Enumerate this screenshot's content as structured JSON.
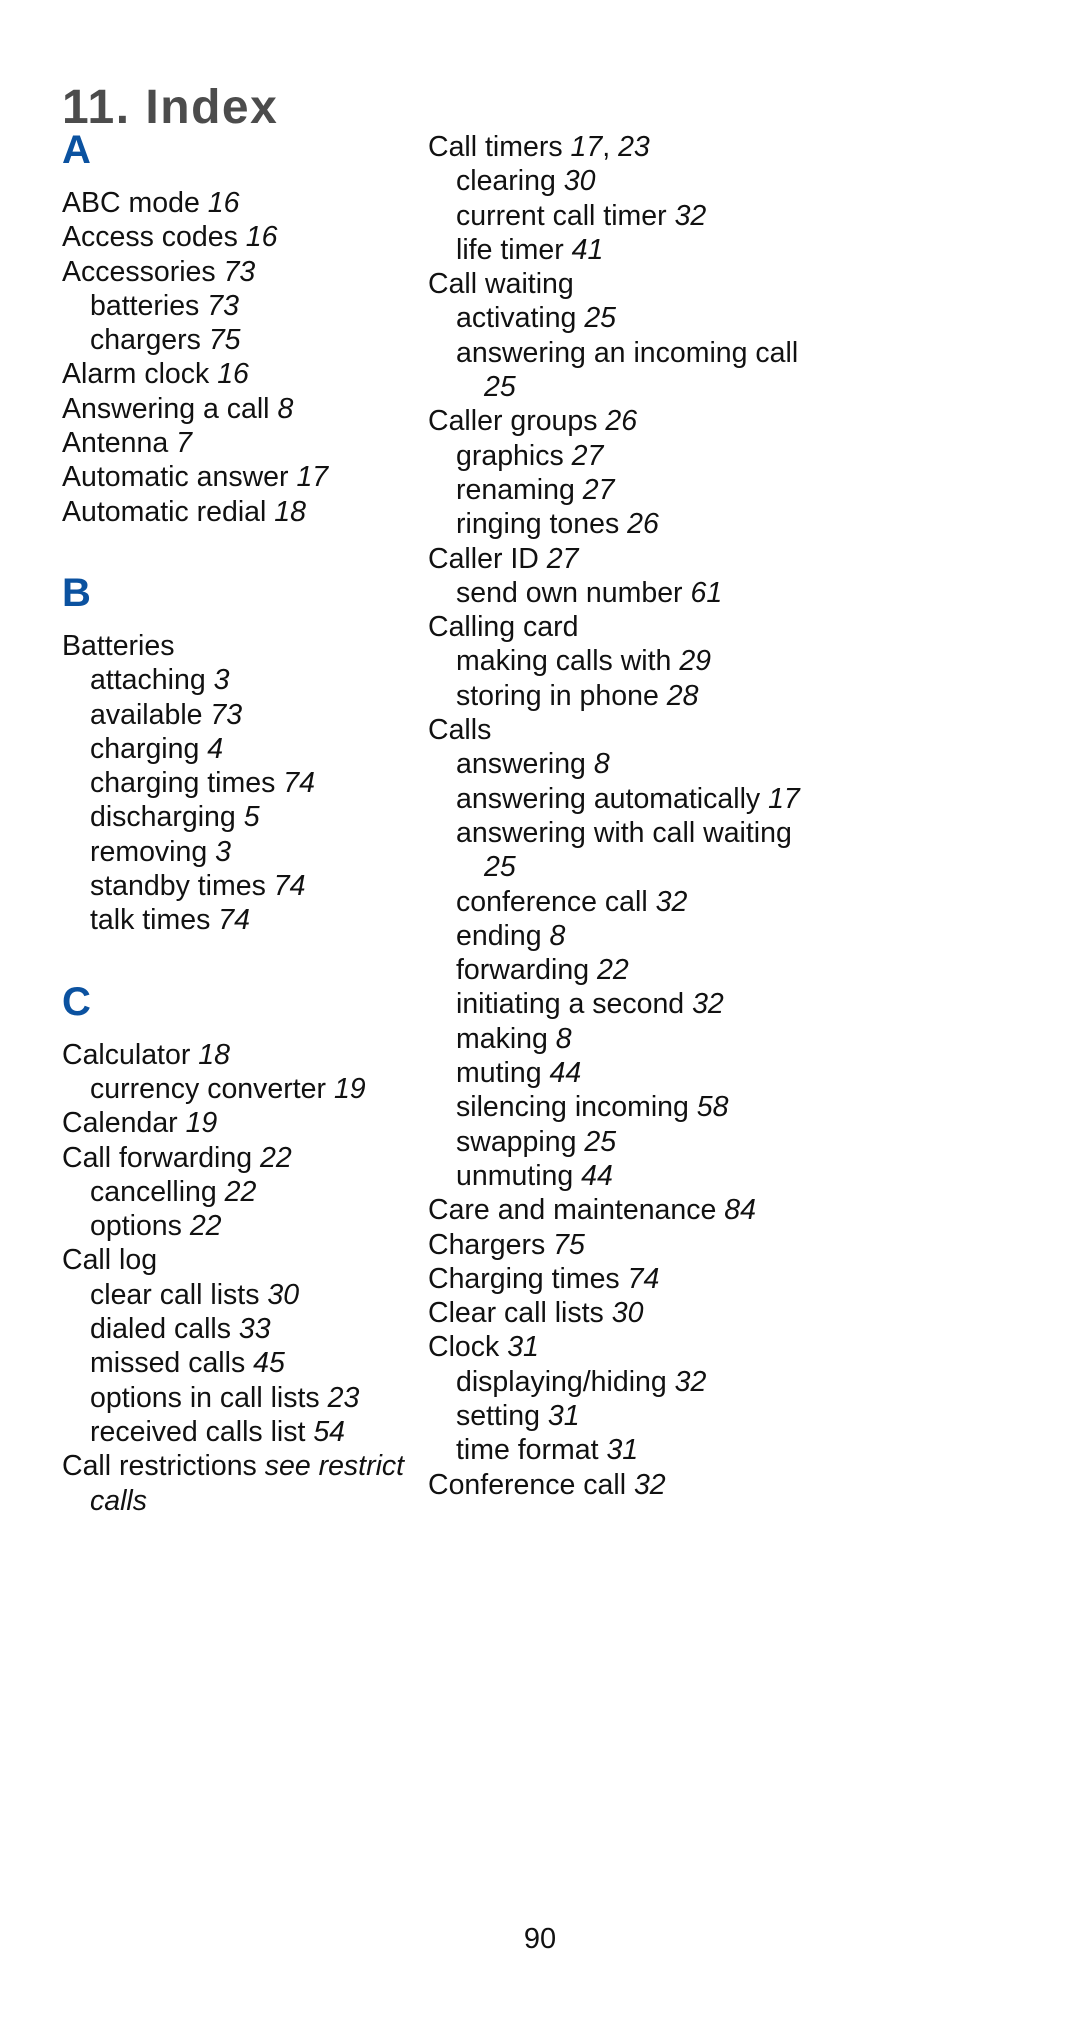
{
  "document": {
    "title": "11. Index",
    "folio": "90",
    "colors": {
      "title": "#4c4c4c",
      "section_letter": "#0b52a0",
      "body_text": "#111111",
      "background": "#ffffff"
    }
  },
  "columns": {
    "left": [
      {
        "kind": "letter",
        "label": "A",
        "spaced": false
      },
      {
        "kind": "entry",
        "level": 0,
        "text": "ABC mode",
        "page": "16"
      },
      {
        "kind": "entry",
        "level": 0,
        "text": "Access codes",
        "page": "16"
      },
      {
        "kind": "entry",
        "level": 0,
        "text": "Accessories",
        "page": "73"
      },
      {
        "kind": "entry",
        "level": 1,
        "text": "batteries",
        "page": "73"
      },
      {
        "kind": "entry",
        "level": 1,
        "text": "chargers",
        "page": "75"
      },
      {
        "kind": "entry",
        "level": 0,
        "text": "Alarm clock",
        "page": "16"
      },
      {
        "kind": "entry",
        "level": 0,
        "text": "Answering a call",
        "page": "8"
      },
      {
        "kind": "entry",
        "level": 0,
        "text": "Antenna",
        "page": "7"
      },
      {
        "kind": "entry",
        "level": 0,
        "text": "Automatic answer",
        "page": "17"
      },
      {
        "kind": "entry",
        "level": 0,
        "text": "Automatic redial",
        "page": "18"
      },
      {
        "kind": "letter",
        "label": "B",
        "spaced": true
      },
      {
        "kind": "entry",
        "level": 0,
        "text": "Batteries",
        "page": ""
      },
      {
        "kind": "entry",
        "level": 1,
        "text": "attaching",
        "page": "3"
      },
      {
        "kind": "entry",
        "level": 1,
        "text": "available",
        "page": "73"
      },
      {
        "kind": "entry",
        "level": 1,
        "text": "charging",
        "page": "4"
      },
      {
        "kind": "entry",
        "level": 1,
        "text": "charging times",
        "page": "74"
      },
      {
        "kind": "entry",
        "level": 1,
        "text": "discharging",
        "page": "5"
      },
      {
        "kind": "entry",
        "level": 1,
        "text": "removing",
        "page": "3"
      },
      {
        "kind": "entry",
        "level": 1,
        "text": "standby times",
        "page": "74"
      },
      {
        "kind": "entry",
        "level": 1,
        "text": "talk times",
        "page": "74"
      },
      {
        "kind": "letter",
        "label": "C",
        "spaced": true
      },
      {
        "kind": "entry",
        "level": 0,
        "text": "Calculator",
        "page": "18"
      },
      {
        "kind": "entry",
        "level": 1,
        "text": "currency converter",
        "page": "19"
      },
      {
        "kind": "entry",
        "level": 0,
        "text": "Calendar",
        "page": "19"
      },
      {
        "kind": "entry",
        "level": 0,
        "text": "Call forwarding",
        "page": "22"
      },
      {
        "kind": "entry",
        "level": 1,
        "text": "cancelling",
        "page": "22"
      },
      {
        "kind": "entry",
        "level": 1,
        "text": "options",
        "page": "22"
      },
      {
        "kind": "entry",
        "level": 0,
        "text": "Call log",
        "page": ""
      },
      {
        "kind": "entry",
        "level": 1,
        "text": "clear call lists",
        "page": "30"
      },
      {
        "kind": "entry",
        "level": 1,
        "text": "dialed calls",
        "page": "33"
      },
      {
        "kind": "entry",
        "level": 1,
        "text": "missed calls",
        "page": "45"
      },
      {
        "kind": "entry",
        "level": 1,
        "text": "options in call lists",
        "page": "23"
      },
      {
        "kind": "entry",
        "level": 1,
        "text": "received calls list",
        "page": "54"
      },
      {
        "kind": "xref",
        "level": 0,
        "text": "Call restrictions ",
        "see": "see restrict calls"
      }
    ],
    "right": [
      {
        "kind": "entry",
        "level": 0,
        "text": "Call timers",
        "page": "17",
        "page2": "23"
      },
      {
        "kind": "entry",
        "level": 1,
        "text": "clearing",
        "page": "30"
      },
      {
        "kind": "entry",
        "level": 1,
        "text": "current call timer",
        "page": "32"
      },
      {
        "kind": "entry",
        "level": 1,
        "text": "life timer",
        "page": "41"
      },
      {
        "kind": "entry",
        "level": 0,
        "text": "Call waiting",
        "page": ""
      },
      {
        "kind": "entry",
        "level": 1,
        "text": "activating",
        "page": "25"
      },
      {
        "kind": "entry",
        "level": 1,
        "text": "answering an incoming call",
        "page": "25"
      },
      {
        "kind": "entry",
        "level": 0,
        "text": "Caller groups",
        "page": "26"
      },
      {
        "kind": "entry",
        "level": 1,
        "text": "graphics",
        "page": "27"
      },
      {
        "kind": "entry",
        "level": 1,
        "text": "renaming",
        "page": "27"
      },
      {
        "kind": "entry",
        "level": 1,
        "text": "ringing tones",
        "page": "26"
      },
      {
        "kind": "entry",
        "level": 0,
        "text": "Caller ID",
        "page": "27"
      },
      {
        "kind": "entry",
        "level": 1,
        "text": "send own number",
        "page": "61"
      },
      {
        "kind": "entry",
        "level": 0,
        "text": "Calling card",
        "page": ""
      },
      {
        "kind": "entry",
        "level": 1,
        "text": "making calls with",
        "page": "29"
      },
      {
        "kind": "entry",
        "level": 1,
        "text": "storing in phone",
        "page": "28"
      },
      {
        "kind": "entry",
        "level": 0,
        "text": "Calls",
        "page": ""
      },
      {
        "kind": "entry",
        "level": 1,
        "text": "answering",
        "page": "8"
      },
      {
        "kind": "entry",
        "level": 1,
        "text": "answering automatically",
        "page": "17"
      },
      {
        "kind": "entry",
        "level": 1,
        "text": "answering with call waiting",
        "page": "25"
      },
      {
        "kind": "entry",
        "level": 1,
        "text": "conference call",
        "page": "32"
      },
      {
        "kind": "entry",
        "level": 1,
        "text": "ending",
        "page": "8"
      },
      {
        "kind": "entry",
        "level": 1,
        "text": "forwarding",
        "page": "22"
      },
      {
        "kind": "entry",
        "level": 1,
        "text": "initiating a second",
        "page": "32"
      },
      {
        "kind": "entry",
        "level": 1,
        "text": "making",
        "page": "8"
      },
      {
        "kind": "entry",
        "level": 1,
        "text": "muting",
        "page": "44"
      },
      {
        "kind": "entry",
        "level": 1,
        "text": "silencing incoming",
        "page": "58"
      },
      {
        "kind": "entry",
        "level": 1,
        "text": "swapping",
        "page": "25"
      },
      {
        "kind": "entry",
        "level": 1,
        "text": "unmuting",
        "page": "44"
      },
      {
        "kind": "entry",
        "level": 0,
        "text": "Care and maintenance",
        "page": "84"
      },
      {
        "kind": "entry",
        "level": 0,
        "text": "Chargers",
        "page": "75"
      },
      {
        "kind": "entry",
        "level": 0,
        "text": "Charging times",
        "page": "74"
      },
      {
        "kind": "entry",
        "level": 0,
        "text": "Clear call lists",
        "page": "30"
      },
      {
        "kind": "entry",
        "level": 0,
        "text": "Clock",
        "page": "31"
      },
      {
        "kind": "entry",
        "level": 1,
        "text": "displaying/hiding",
        "page": "32"
      },
      {
        "kind": "entry",
        "level": 1,
        "text": "setting",
        "page": "31"
      },
      {
        "kind": "entry",
        "level": 1,
        "text": "time format",
        "page": "31"
      },
      {
        "kind": "entry",
        "level": 0,
        "text": "Conference call",
        "page": "32"
      }
    ]
  }
}
